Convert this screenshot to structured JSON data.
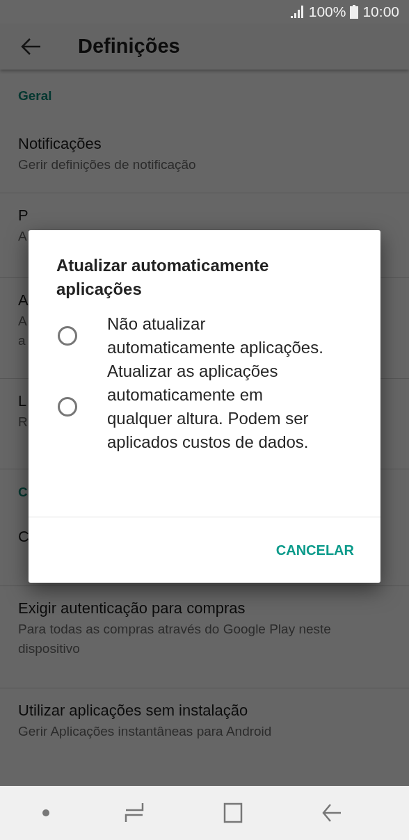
{
  "status_bar": {
    "battery": "100%",
    "time": "10:00"
  },
  "app_bar": {
    "title": "Definições"
  },
  "list": [
    {
      "kind": "header",
      "title": "Geral"
    },
    {
      "kind": "item",
      "title": "Notificações",
      "subtitle": "Gerir definições de notificação"
    },
    {
      "kind": "item",
      "title": "P",
      "subtitle": "A"
    },
    {
      "kind": "item",
      "title": "A",
      "subtitle": "A",
      "subtitle_2": "a"
    },
    {
      "kind": "item",
      "title": "L",
      "subtitle": "R"
    },
    {
      "kind": "header",
      "title": "C"
    },
    {
      "kind": "item",
      "title": "C"
    },
    {
      "kind": "item",
      "title": "Exigir autenticação para compras",
      "subtitle": "Para todas as compras através do Google Play neste dispositivo"
    },
    {
      "kind": "item",
      "title": "Utilizar aplicações sem instalação",
      "subtitle": "Gerir Aplicações instantâneas para Android"
    }
  ],
  "dialog": {
    "title": "Atualizar automaticamente aplicações",
    "options": [
      {
        "label": "Não atualizar automaticamente aplicações.",
        "selected": false
      },
      {
        "label": "Atualizar as aplicações automaticamente em qualquer altura. Podem ser aplicados custos de dados.",
        "selected": false
      }
    ],
    "button": "CANCELAR"
  }
}
